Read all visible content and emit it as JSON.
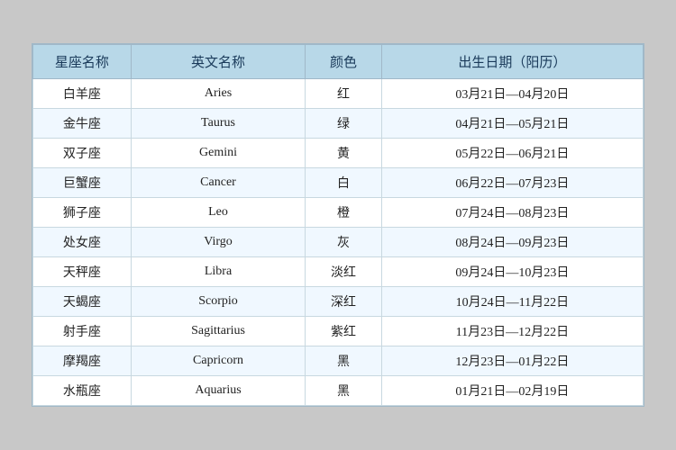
{
  "header": {
    "col1": "星座名称",
    "col2": "英文名称",
    "col3": "颜色",
    "col4": "出生日期（阳历）"
  },
  "rows": [
    {
      "name": "白羊座",
      "en": "Aries",
      "color": "红",
      "date": "03月21日—04月20日"
    },
    {
      "name": "金牛座",
      "en": "Taurus",
      "color": "绿",
      "date": "04月21日—05月21日"
    },
    {
      "name": "双子座",
      "en": "Gemini",
      "color": "黄",
      "date": "05月22日—06月21日"
    },
    {
      "name": "巨蟹座",
      "en": "Cancer",
      "color": "白",
      "date": "06月22日—07月23日"
    },
    {
      "name": "狮子座",
      "en": "Leo",
      "color": "橙",
      "date": "07月24日—08月23日"
    },
    {
      "name": "处女座",
      "en": "Virgo",
      "color": "灰",
      "date": "08月24日—09月23日"
    },
    {
      "name": "天秤座",
      "en": "Libra",
      "color": "淡红",
      "date": "09月24日—10月23日"
    },
    {
      "name": "天蝎座",
      "en": "Scorpio",
      "color": "深红",
      "date": "10月24日—11月22日"
    },
    {
      "name": "射手座",
      "en": "Sagittarius",
      "color": "紫红",
      "date": "11月23日—12月22日"
    },
    {
      "name": "摩羯座",
      "en": "Capricorn",
      "color": "黑",
      "date": "12月23日—01月22日"
    },
    {
      "name": "水瓶座",
      "en": "Aquarius",
      "color": "黑",
      "date": "01月21日—02月19日"
    }
  ]
}
